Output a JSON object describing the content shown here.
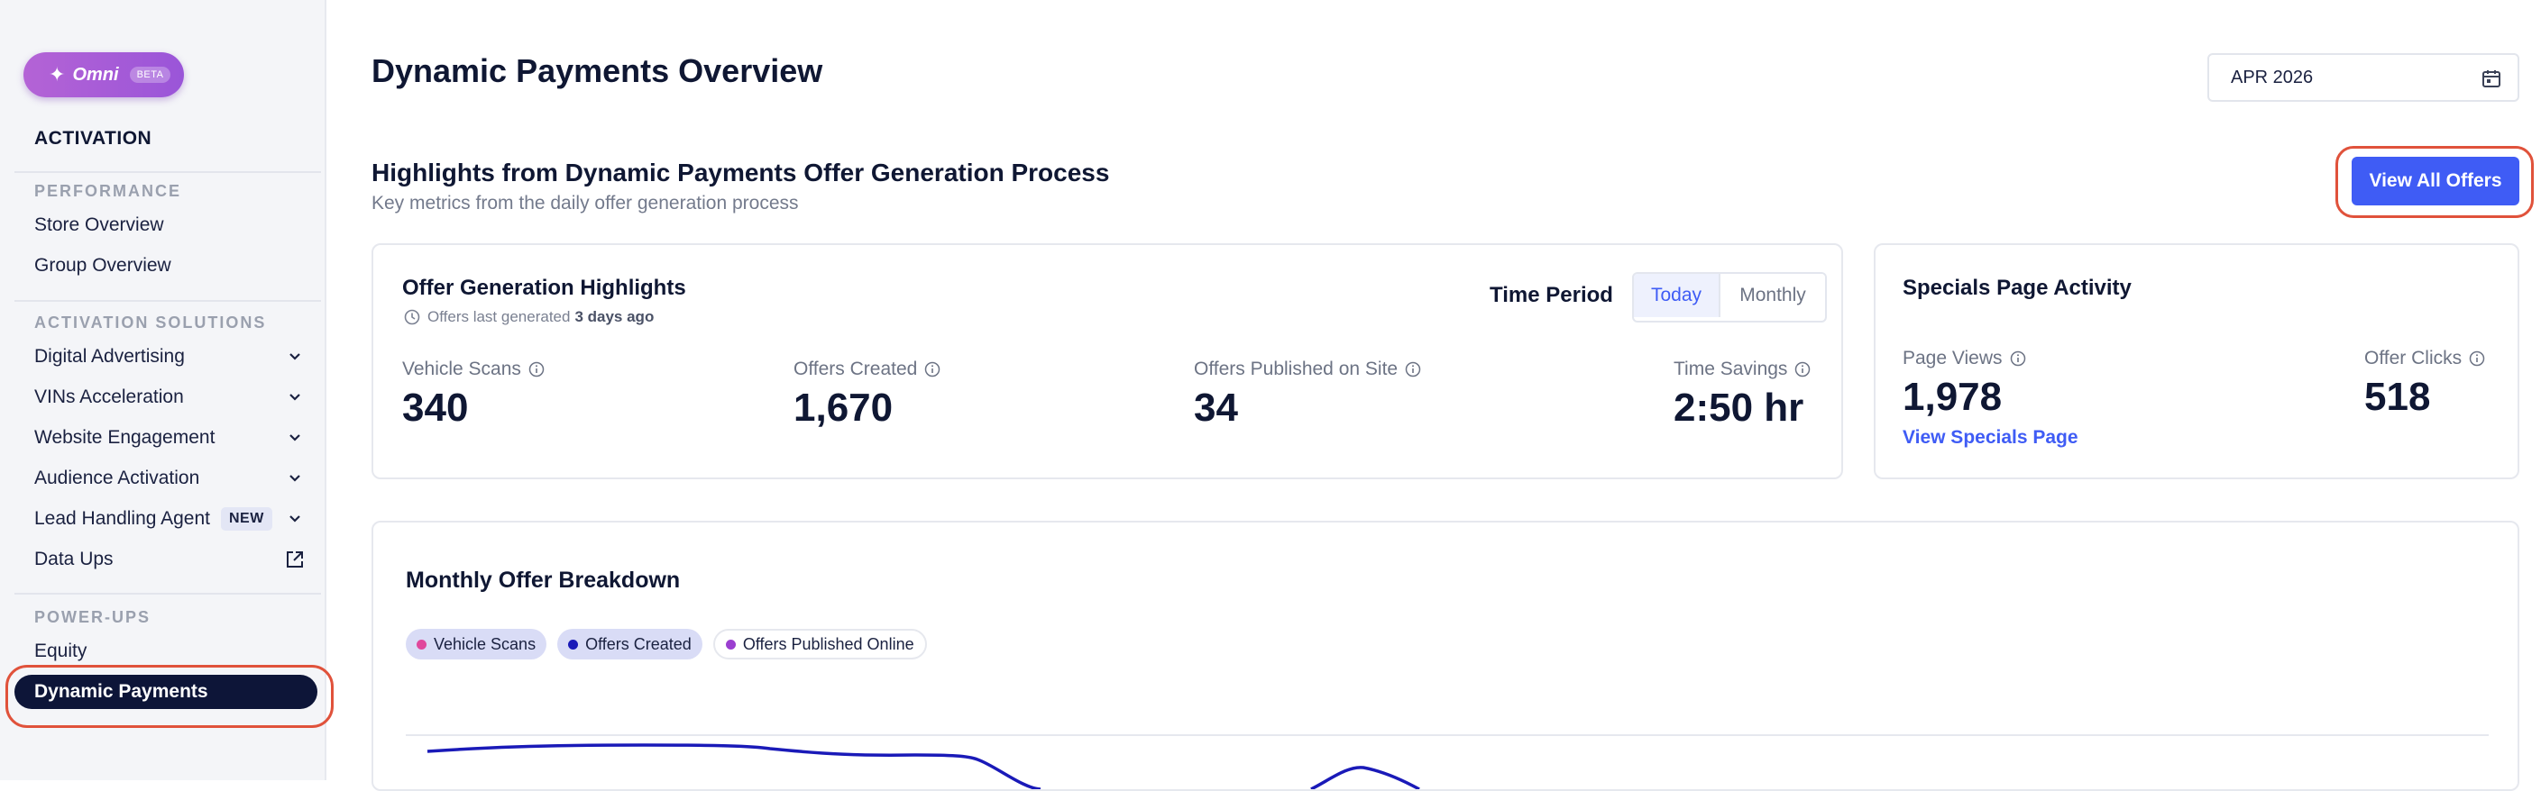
{
  "sidebar": {
    "omni": {
      "label": "Omni",
      "badge": "BETA"
    },
    "heading": "ACTIVATION",
    "sections": {
      "performance": "PERFORMANCE",
      "activation_solutions": "ACTIVATION SOLUTIONS",
      "power_ups": "POWER-UPS"
    },
    "items": {
      "store_overview": "Store Overview",
      "group_overview": "Group Overview",
      "digital_advertising": "Digital Advertising",
      "vins_acceleration": "VINs Acceleration",
      "website_engagement": "Website Engagement",
      "audience_activation": "Audience Activation",
      "lead_handling_agent": "Lead Handling Agent",
      "lead_badge": "NEW",
      "data_ups": "Data Ups",
      "equity": "Equity",
      "dynamic_payments": "Dynamic Payments"
    }
  },
  "header": {
    "title": "Dynamic Payments Overview",
    "date_value": "APR 2026"
  },
  "highlights": {
    "title": "Highlights from Dynamic Payments Offer Generation Process",
    "subtitle": "Key metrics from the daily offer generation process",
    "view_all_label": "View All Offers"
  },
  "offer_card": {
    "title": "Offer Generation Highlights",
    "last_generated_prefix": "Offers last generated",
    "last_generated_value": "3 days ago",
    "time_period_label": "Time Period",
    "period_options": [
      "Today",
      "Monthly"
    ],
    "selected_period": "Today",
    "metrics": [
      {
        "label": "Vehicle Scans",
        "value": "340"
      },
      {
        "label": "Offers Created",
        "value": "1,670"
      },
      {
        "label": "Offers Published on Site",
        "value": "34"
      },
      {
        "label": "Time Savings",
        "value": "2:50 hr"
      }
    ]
  },
  "specials_card": {
    "title": "Specials Page Activity",
    "metrics": [
      {
        "label": "Page Views",
        "value": "1,978"
      },
      {
        "label": "Offer Clicks",
        "value": "518"
      }
    ],
    "link_label": "View Specials Page"
  },
  "monthly_chart": {
    "title": "Monthly Offer Breakdown",
    "legend": [
      {
        "name": "Vehicle Scans",
        "color": "#e0489c",
        "active": true
      },
      {
        "name": "Offers Created",
        "color": "#1a1ab8",
        "active": true
      },
      {
        "name": "Offers Published Online",
        "color": "#9b3fd0",
        "active": false
      }
    ]
  },
  "colors": {
    "accent": "#3f5cf5",
    "sidebar_active": "#0d1538",
    "annotation": "#e0523b"
  }
}
